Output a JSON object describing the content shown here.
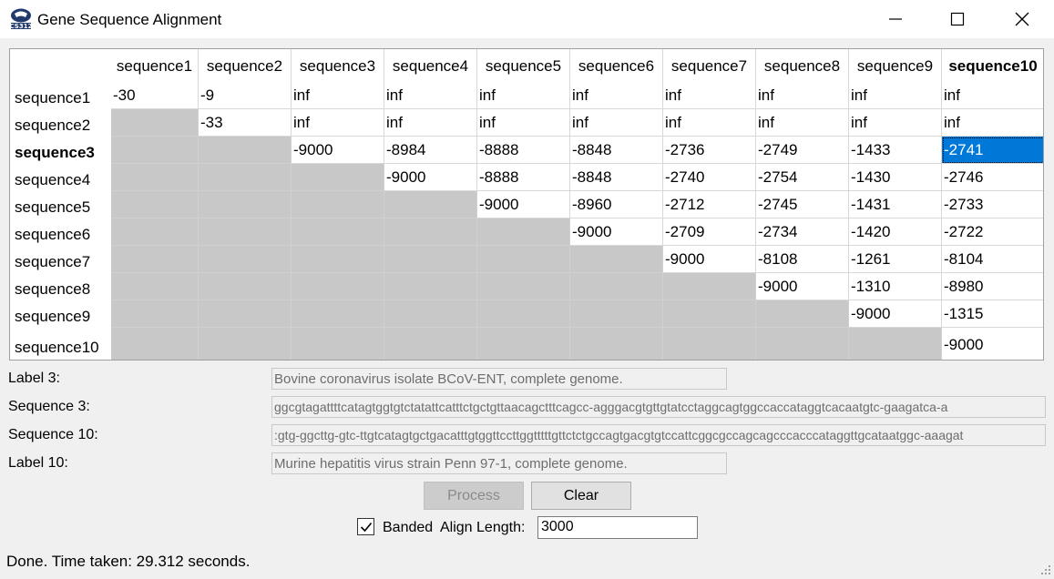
{
  "window": {
    "title": "Gene Sequence Alignment",
    "app_icon": "cs312-logo-icon",
    "controls": [
      "minimize-icon",
      "maximize-icon",
      "close-icon"
    ]
  },
  "table": {
    "columns": [
      "sequence1",
      "sequence2",
      "sequence3",
      "sequence4",
      "sequence5",
      "sequence6",
      "sequence7",
      "sequence8",
      "sequence9",
      "sequence10"
    ],
    "bold_column": "sequence10",
    "bold_row": "sequence3",
    "selected_cell": {
      "row": 2,
      "col": 9
    },
    "rows": [
      {
        "label": "sequence1",
        "cells": [
          "-30",
          "-9",
          "inf",
          "inf",
          "inf",
          "inf",
          "inf",
          "inf",
          "inf",
          "inf"
        ]
      },
      {
        "label": "sequence2",
        "cells": [
          null,
          "-33",
          "inf",
          "inf",
          "inf",
          "inf",
          "inf",
          "inf",
          "inf",
          "inf"
        ]
      },
      {
        "label": "sequence3",
        "cells": [
          null,
          null,
          "-9000",
          "-8984",
          "-8888",
          "-8848",
          "-2736",
          "-2749",
          "-1433",
          "-2741"
        ]
      },
      {
        "label": "sequence4",
        "cells": [
          null,
          null,
          null,
          "-9000",
          "-8888",
          "-8848",
          "-2740",
          "-2754",
          "-1430",
          "-2746"
        ]
      },
      {
        "label": "sequence5",
        "cells": [
          null,
          null,
          null,
          null,
          "-9000",
          "-8960",
          "-2712",
          "-2745",
          "-1431",
          "-2733"
        ]
      },
      {
        "label": "sequence6",
        "cells": [
          null,
          null,
          null,
          null,
          null,
          "-9000",
          "-2709",
          "-2734",
          "-1420",
          "-2722"
        ]
      },
      {
        "label": "sequence7",
        "cells": [
          null,
          null,
          null,
          null,
          null,
          null,
          "-9000",
          "-8108",
          "-1261",
          "-8104"
        ]
      },
      {
        "label": "sequence8",
        "cells": [
          null,
          null,
          null,
          null,
          null,
          null,
          null,
          "-9000",
          "-1310",
          "-8980"
        ]
      },
      {
        "label": "sequence9",
        "cells": [
          null,
          null,
          null,
          null,
          null,
          null,
          null,
          null,
          "-9000",
          "-1315"
        ]
      },
      {
        "label": "sequence10",
        "cells": [
          null,
          null,
          null,
          null,
          null,
          null,
          null,
          null,
          null,
          "-9000"
        ]
      }
    ]
  },
  "details": {
    "label3_caption": "Label 3:",
    "label3_value": "Bovine coronavirus isolate BCoV-ENT, complete genome.",
    "seq3_caption": "Sequence 3:",
    "seq3_value": "ggcgtagattttcatagtggtgtctatattcatttctgctgttaacagctttcagcc-agggacgtgttgtatcctaggcagtggccaccataggtcacaatgtc-gaagatca-a",
    "seq10_caption": "Sequence 10:",
    "seq10_value": ":gtg-ggcttg-gtc-ttgtcatagtgctgacatttgtggttccttggtttttgttctctgccagtgacgtgtccattcggcgccagcagcccacccataggttgcataatggc-aaagat",
    "label10_caption": "Label 10:",
    "label10_value": "Murine hepatitis virus strain Penn 97-1, complete genome."
  },
  "controls": {
    "process_label": "Process",
    "clear_label": "Clear",
    "banded_label": "Banded",
    "banded_checked": true,
    "align_length_label": "Align Length:",
    "align_length_value": "3000"
  },
  "status": {
    "text": "Done.  Time taken: 29.312 seconds."
  },
  "colors": {
    "selection": "#0078d7",
    "inactive_cell": "#c8c8c8",
    "background": "#f0f0f0"
  }
}
